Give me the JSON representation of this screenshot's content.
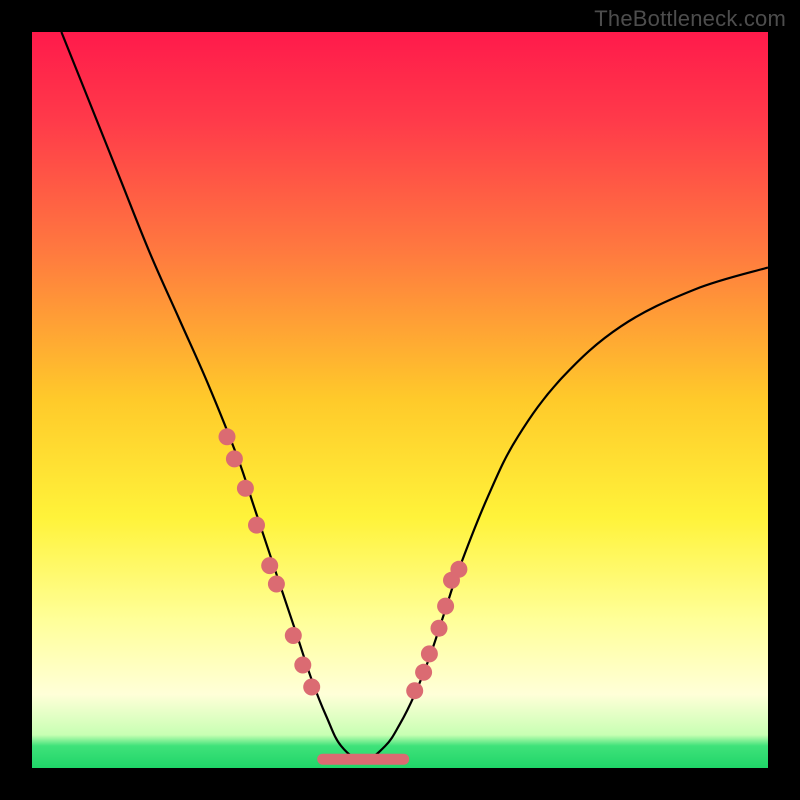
{
  "watermark": "TheBottleneck.com",
  "colors": {
    "background_frame": "#000000",
    "curve_stroke": "#000000",
    "marker_fill": "#db6b72",
    "watermark_text": "#4d4d4d"
  },
  "gradient_stops": [
    {
      "pct": 0,
      "color": "#ff1a4b"
    },
    {
      "pct": 12,
      "color": "#ff3a4a"
    },
    {
      "pct": 30,
      "color": "#ff7a3f"
    },
    {
      "pct": 50,
      "color": "#ffca2a"
    },
    {
      "pct": 66,
      "color": "#fff33a"
    },
    {
      "pct": 80,
      "color": "#ffff9a"
    },
    {
      "pct": 90,
      "color": "#ffffd8"
    },
    {
      "pct": 95.5,
      "color": "#c8ffb3"
    },
    {
      "pct": 97,
      "color": "#3fe27a"
    },
    {
      "pct": 100,
      "color": "#1fd568"
    }
  ],
  "chart_data": {
    "type": "line",
    "title": "",
    "xlabel": "",
    "ylabel": "",
    "xlim": [
      0,
      100
    ],
    "ylim": [
      0,
      100
    ],
    "note": "x=0..100 normalized horizontal position; y=0..100 where 0=bottom, 100=top. Curve is a V-shaped bottleneck profile dipping to ~0 at x≈45.",
    "series": [
      {
        "name": "bottleneck-curve",
        "x": [
          4,
          8,
          12,
          16,
          20,
          24,
          28,
          30,
          32,
          34,
          36,
          38,
          40,
          42,
          45,
          48,
          50,
          52,
          54,
          56,
          58,
          62,
          66,
          72,
          80,
          90,
          100
        ],
        "y": [
          100,
          90,
          80,
          70,
          61,
          52,
          42,
          36,
          30,
          24,
          18,
          12,
          7,
          3,
          1,
          3,
          6,
          10,
          15,
          21,
          27,
          37,
          45,
          53,
          60,
          65,
          68
        ]
      }
    ],
    "markers": {
      "name": "highlighted-points",
      "x": [
        26.5,
        27.5,
        29.0,
        30.5,
        32.3,
        33.2,
        35.5,
        36.8,
        38.0,
        52.0,
        53.2,
        54.0,
        55.3,
        56.2,
        57.0,
        58.0
      ],
      "y": [
        45.0,
        42.0,
        38.0,
        33.0,
        27.5,
        25.0,
        18.0,
        14.0,
        11.0,
        10.5,
        13.0,
        15.5,
        19.0,
        22.0,
        25.5,
        27.0
      ]
    },
    "trough_bar": {
      "x_start": 39.5,
      "x_end": 50.5,
      "y": 1.2
    }
  }
}
